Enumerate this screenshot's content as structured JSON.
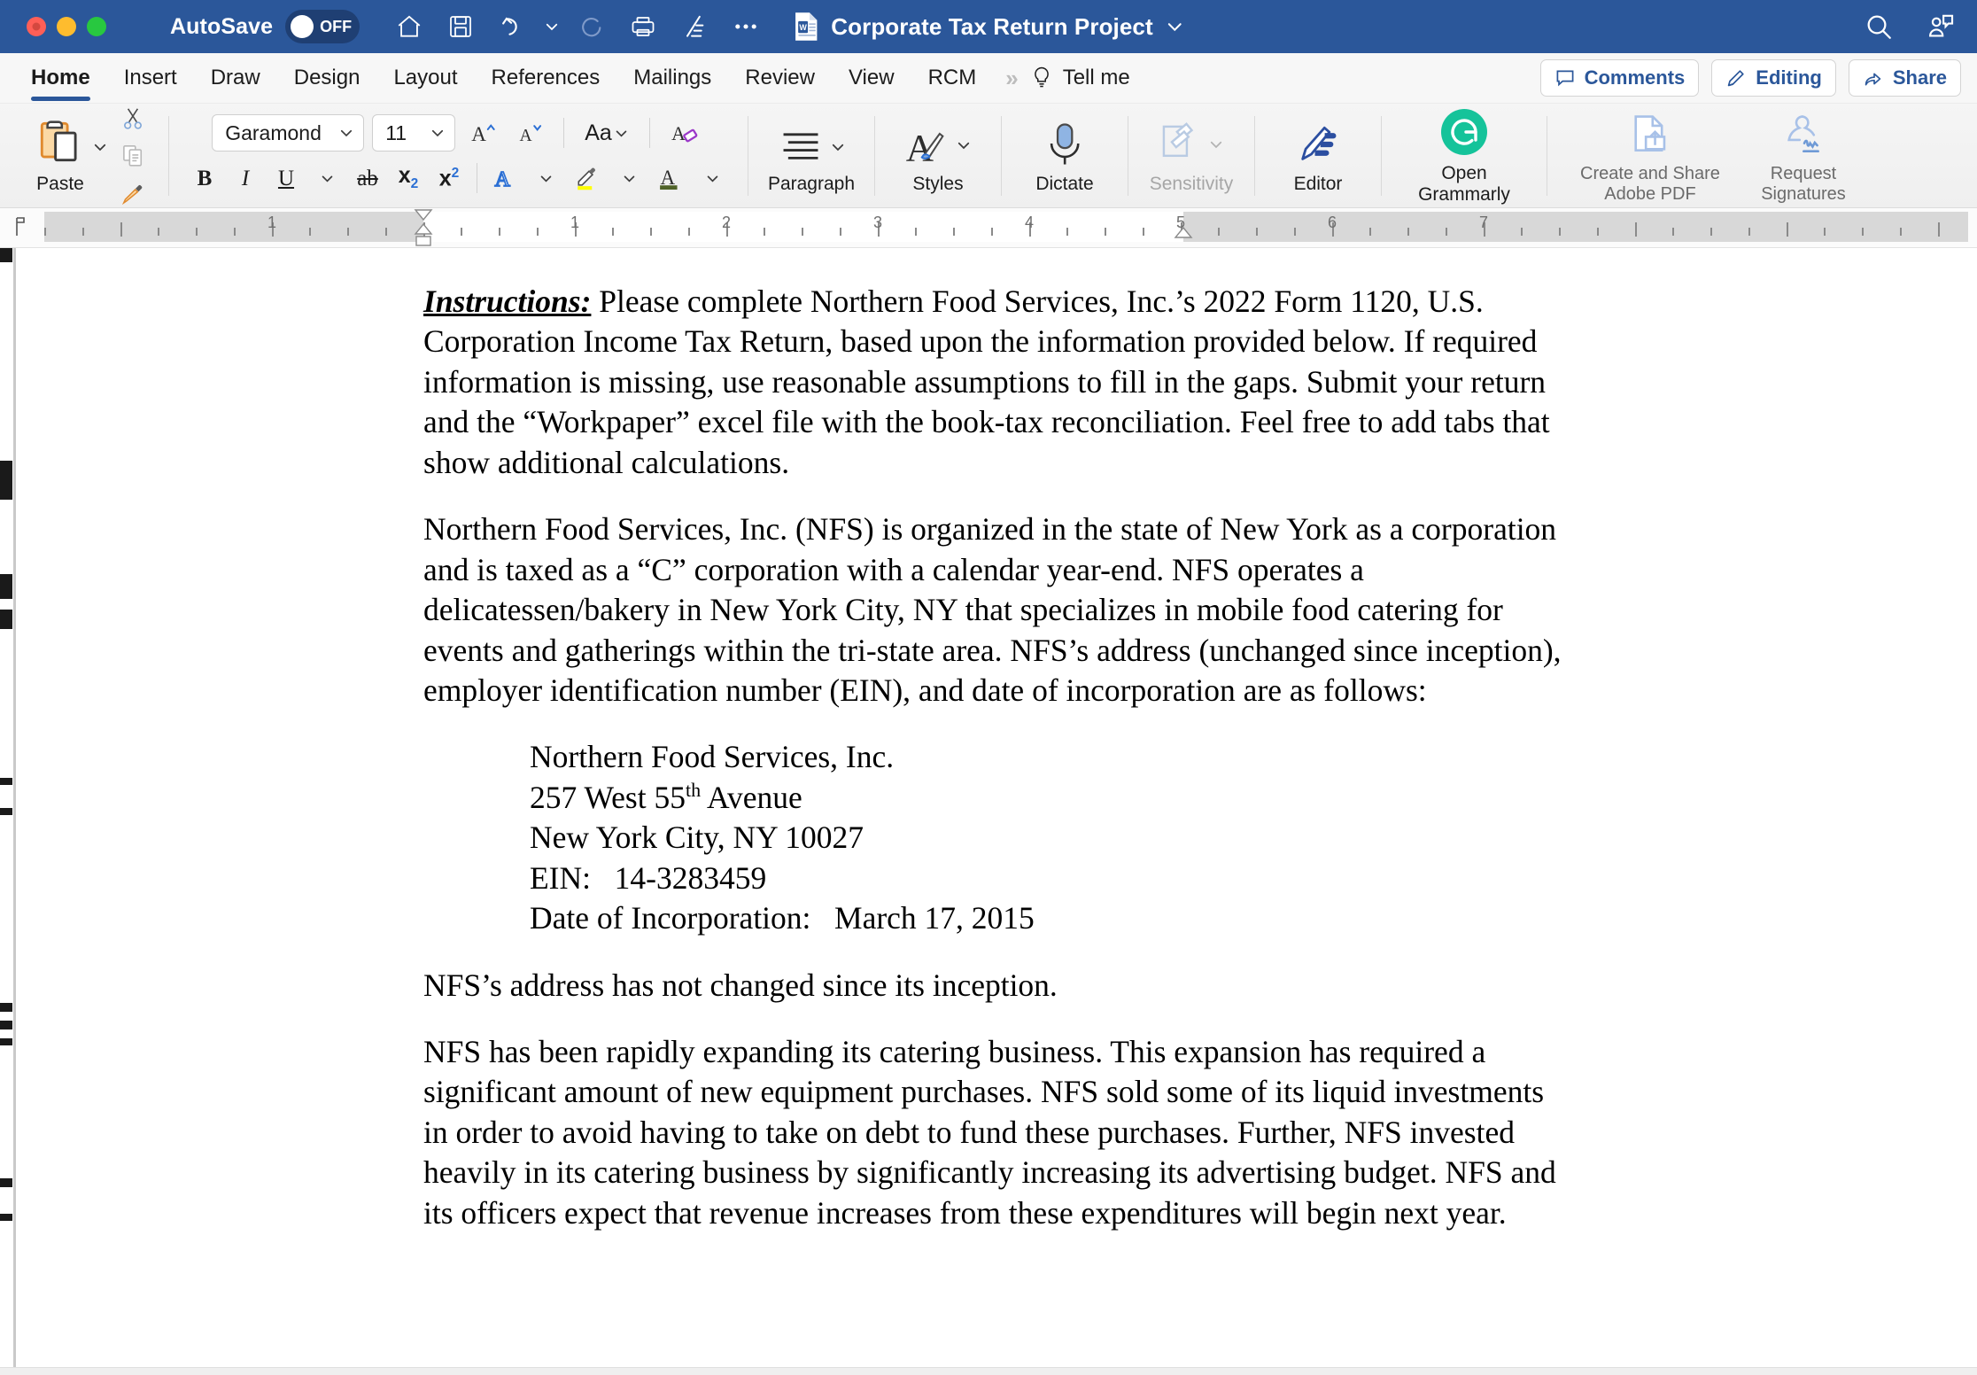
{
  "titlebar": {
    "autosave_label": "AutoSave",
    "autosave_state": "OFF",
    "document_title": "Corporate Tax Return Project",
    "quick_access": [
      {
        "name": "home-icon",
        "label": "Home"
      },
      {
        "name": "save-icon",
        "label": "Save"
      },
      {
        "name": "undo-icon",
        "label": "Undo"
      },
      {
        "name": "redo-icon",
        "label": "Redo"
      },
      {
        "name": "print-icon",
        "label": "Print"
      },
      {
        "name": "editor-pen-icon",
        "label": "Editor"
      },
      {
        "name": "more-options-icon",
        "label": "More"
      }
    ],
    "right_icons": [
      {
        "name": "search-icon",
        "label": "Search"
      },
      {
        "name": "copilot-icon",
        "label": "Copilot"
      }
    ],
    "background_color": "#2b579a"
  },
  "tabbar": {
    "tabs": [
      {
        "label": "Home",
        "active": true
      },
      {
        "label": "Insert",
        "active": false
      },
      {
        "label": "Draw",
        "active": false
      },
      {
        "label": "Design",
        "active": false
      },
      {
        "label": "Layout",
        "active": false
      },
      {
        "label": "References",
        "active": false
      },
      {
        "label": "Mailings",
        "active": false
      },
      {
        "label": "Review",
        "active": false
      },
      {
        "label": "View",
        "active": false
      },
      {
        "label": "RCM",
        "active": false
      }
    ],
    "overflow_label": "»",
    "tell_me_label": "Tell me",
    "comments_label": "Comments",
    "editing_label": "Editing",
    "share_label": "Share",
    "accent_color": "#2b579a"
  },
  "ribbon": {
    "paste_label": "Paste",
    "cut_label": "Cut",
    "copy_label": "Copy",
    "format_painter_label": "Format Painter",
    "font_name": "Garamond",
    "font_size": "11",
    "grow_font_label": "Grow Font",
    "shrink_font_label": "Shrink Font",
    "change_case_label": "Aa",
    "clear_formatting_label": "Clear Formatting",
    "bold_label": "B",
    "italic_label": "I",
    "underline_label": "U",
    "strikethrough_label": "ab",
    "subscript_label": "x",
    "subscript_sub": "2",
    "superscript_label": "x",
    "superscript_sup": "2",
    "text_effects_label": "A",
    "highlight_label": "Text Highlight Color",
    "font_color_label": "A",
    "font_color_swatch": "#4f6228",
    "highlight_swatch": "#ffff00",
    "paragraph_label": "Paragraph",
    "styles_label": "Styles",
    "dictate_label": "Dictate",
    "sensitivity_label": "Sensitivity",
    "editor_label": "Editor",
    "grammarly_label_line1": "Open",
    "grammarly_label_line2": "Grammarly",
    "grammarly_color": "#15c39a",
    "adobe_pdf_line1": "Create and Share",
    "adobe_pdf_line2": "Adobe PDF",
    "request_sig_line1": "Request",
    "request_sig_line2": "Signatures"
  },
  "ruler": {
    "numbers": [
      "1",
      "1",
      "2",
      "3",
      "4",
      "5",
      "6",
      "7"
    ],
    "left_margin_label": "1",
    "unit": "inches"
  },
  "document": {
    "paragraphs": [
      {
        "id": "p-instructions",
        "lead_label": "Instructions:",
        "text": " Please complete Northern Food Services, Inc.’s 2022 Form 1120, U.S. Corporation Income Tax Return, based upon the information provided below.  If required information is missing, use reasonable assumptions to fill in the gaps. Submit your return and the “Workpaper” excel file with the book-tax reconciliation. Feel free to add tabs that show additional calculations."
      },
      {
        "id": "p-overview",
        "text": "Northern Food Services, Inc. (NFS) is organized in the state of New York as a corporation and is taxed as a “C” corporation with a calendar year-end.  NFS operates a delicatessen/bakery in New York City, NY that specializes in mobile food catering for events and gatherings within the tri-state area.  NFS’s address (unchanged since inception), employer identification number (EIN), and date of incorporation are as follows:"
      },
      {
        "id": "p-address-unchanged",
        "text": "NFS’s address has not changed since its inception."
      },
      {
        "id": "p-expansion",
        "text": "NFS has been rapidly expanding its catering business.  This expansion has required a significant amount of new equipment purchases.  NFS sold some of its liquid investments in order to avoid having to take on debt to fund these purchases.  Further, NFS invested heavily in its catering business by significantly increasing its advertising budget.  NFS and its officers expect that revenue increases from these expenditures will begin next year."
      }
    ],
    "address_block": {
      "company": "Northern Food Services, Inc.",
      "street_number": "257 West 55",
      "street_suffix": "th",
      "street_rest": " Avenue",
      "city_state_zip": "New York City, NY 10027",
      "ein_label": "EIN:",
      "ein_value": "14-3283459",
      "incorporation_label": "Date of Incorporation:",
      "incorporation_value": "March 17, 2015"
    }
  }
}
